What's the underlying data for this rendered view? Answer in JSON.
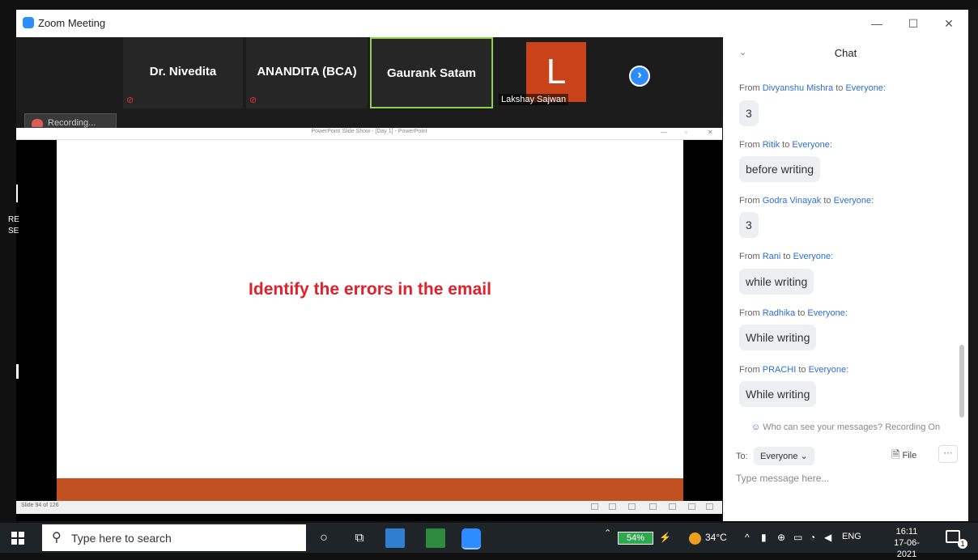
{
  "window": {
    "title": "Zoom Meeting",
    "controls": {
      "minimize": "—",
      "maximize": "☐",
      "close": "✕"
    }
  },
  "participants": [
    {
      "name": "Dr. Nivedita",
      "muted": true
    },
    {
      "name": "ANANDITA (BCA)",
      "muted": true
    },
    {
      "name": "Gaurank Satam",
      "active_speaker": true
    },
    {
      "name": "Lakshay Sajwan",
      "avatar_letter": "L",
      "avatar_color": "#c8421a"
    }
  ],
  "recording_label": "Recording...",
  "share": {
    "window_title": "PowerPoint Slide Show - [Day 1] - PowerPoint",
    "slide_text": "Identify the errors in the email",
    "slide_counter": "Slide 94 of 126",
    "left_edge_text": [
      "RE",
      "SE"
    ]
  },
  "chat": {
    "title": "Chat",
    "messages": [
      {
        "prefix": "From ",
        "sender": "Divyanshu Mishra",
        "mid": " to ",
        "recipient": "Everyone:",
        "text": "3"
      },
      {
        "prefix": "From ",
        "sender": "Ritik",
        "mid": " to ",
        "recipient": "Everyone:",
        "text": "before writing"
      },
      {
        "prefix": "From ",
        "sender": "Godra Vinayak",
        "mid": " to ",
        "recipient": "Everyone:",
        "text": "3"
      },
      {
        "prefix": "From ",
        "sender": "Rani",
        "mid": " to ",
        "recipient": "Everyone:",
        "text": "while writing"
      },
      {
        "prefix": "From ",
        "sender": "Radhika",
        "mid": " to ",
        "recipient": "Everyone:",
        "text": "While writing"
      },
      {
        "prefix": "From ",
        "sender": "PRACHI",
        "mid": " to ",
        "recipient": "Everyone:",
        "text": "While writing"
      }
    ],
    "privacy_note": "Who can see your messages? Recording On",
    "to_label": "To:",
    "recipient_select": "Everyone",
    "file_label": "File",
    "more_label": "···",
    "input_placeholder": "Type message here..."
  },
  "taskbar": {
    "search_placeholder": "Type here to search",
    "battery": "54%",
    "temperature": "34°C",
    "language": "ENG",
    "time": "16:11",
    "date": "17-06-2021",
    "notifications": "1"
  },
  "colors": {
    "zoom_blue": "#2d8cff",
    "slide_text_red": "#e0202a",
    "slide_bar_orange": "#c0501f",
    "active_speaker_green": "#8fd14f",
    "sender_blue": "#2d6fd8"
  }
}
